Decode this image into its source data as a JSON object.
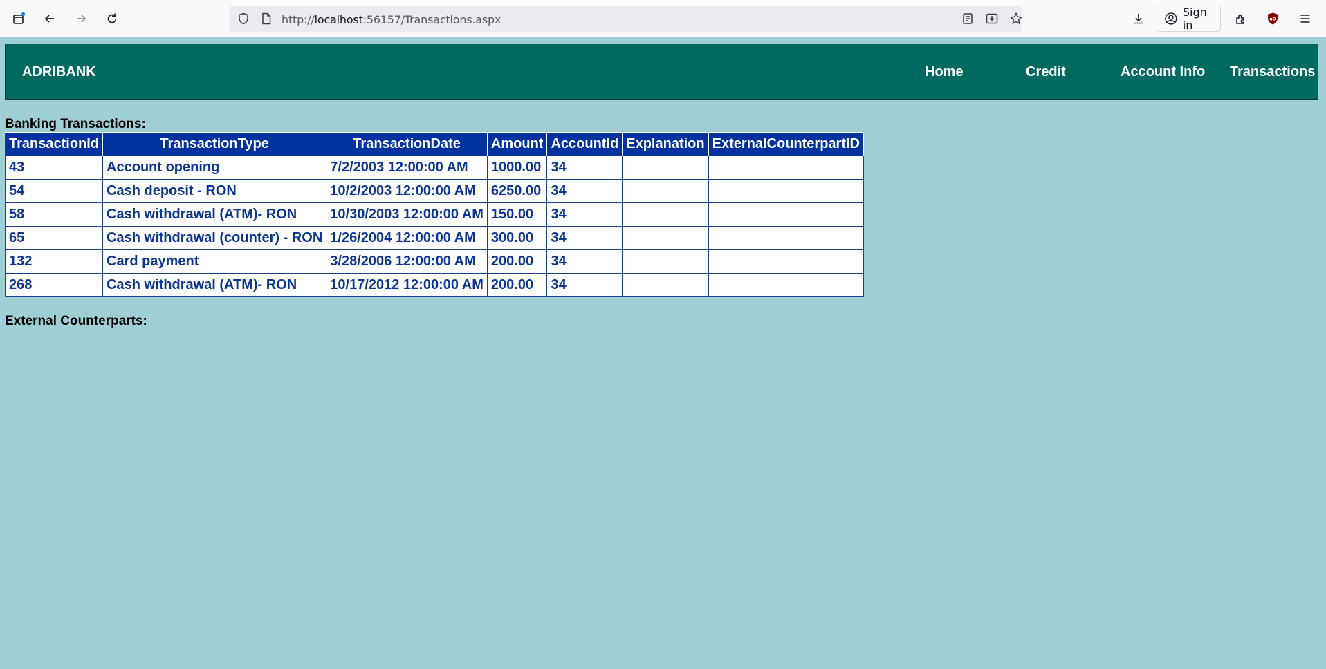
{
  "browser": {
    "url_prefix": "http://",
    "url_host": "localhost",
    "url_rest": ":56157/Transactions.aspx",
    "sign_in_label": "Sign in"
  },
  "navbar": {
    "brand": "ADRIBANK",
    "links": [
      "Home",
      "Credit",
      "Account Info",
      "Transactions"
    ],
    "color": "#006a60"
  },
  "transactions": {
    "title": "Banking Transactions:",
    "headers": [
      "TransactionId",
      "TransactionType",
      "TransactionDate",
      "Amount",
      "AccountId",
      "Explanation",
      "ExternalCounterpartID"
    ],
    "rows": [
      [
        "43",
        "Account opening",
        "7/2/2003 12:00:00 AM",
        "1000.00",
        "34",
        "",
        ""
      ],
      [
        "54",
        "Cash deposit - RON",
        "10/2/2003 12:00:00 AM",
        "6250.00",
        "34",
        "",
        ""
      ],
      [
        "58",
        "Cash withdrawal (ATM)- RON",
        "10/30/2003 12:00:00 AM",
        "150.00",
        "34",
        "",
        ""
      ],
      [
        "65",
        "Cash withdrawal (counter) - RON",
        "1/26/2004 12:00:00 AM",
        "300.00",
        "34",
        "",
        ""
      ],
      [
        "132",
        "Card payment",
        "3/28/2006 12:00:00 AM",
        "200.00",
        "34",
        "",
        ""
      ],
      [
        "268",
        "Cash withdrawal (ATM)- RON",
        "10/17/2012 12:00:00 AM",
        "200.00",
        "34",
        "",
        ""
      ]
    ]
  },
  "counterparts": {
    "title": "External Counterparts:"
  },
  "colors": {
    "page_background": "#a0ced5",
    "header_background": "#0033a0",
    "cell_text": "#0a3595"
  }
}
